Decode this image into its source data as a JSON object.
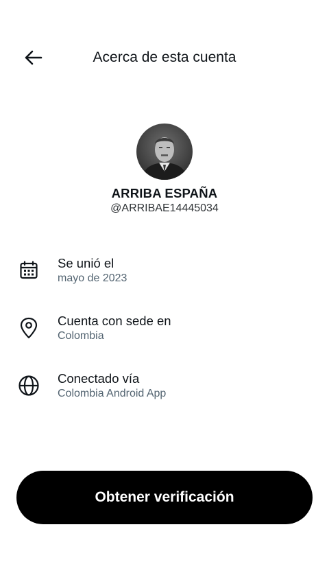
{
  "header": {
    "title": "Acerca de esta cuenta",
    "back_icon": "arrow-left-icon"
  },
  "profile": {
    "display_name": "ARRIBA ESPAÑA",
    "handle": "@ARRIBAE14445034"
  },
  "info": [
    {
      "icon": "calendar-icon",
      "label": "Se unió el",
      "value": "mayo de 2023"
    },
    {
      "icon": "location-pin-icon",
      "label": "Cuenta con sede en",
      "value": "Colombia"
    },
    {
      "icon": "globe-icon",
      "label": "Conectado vía",
      "value": "Colombia Android App"
    }
  ],
  "actions": {
    "verify_label": "Obtener verificación"
  }
}
